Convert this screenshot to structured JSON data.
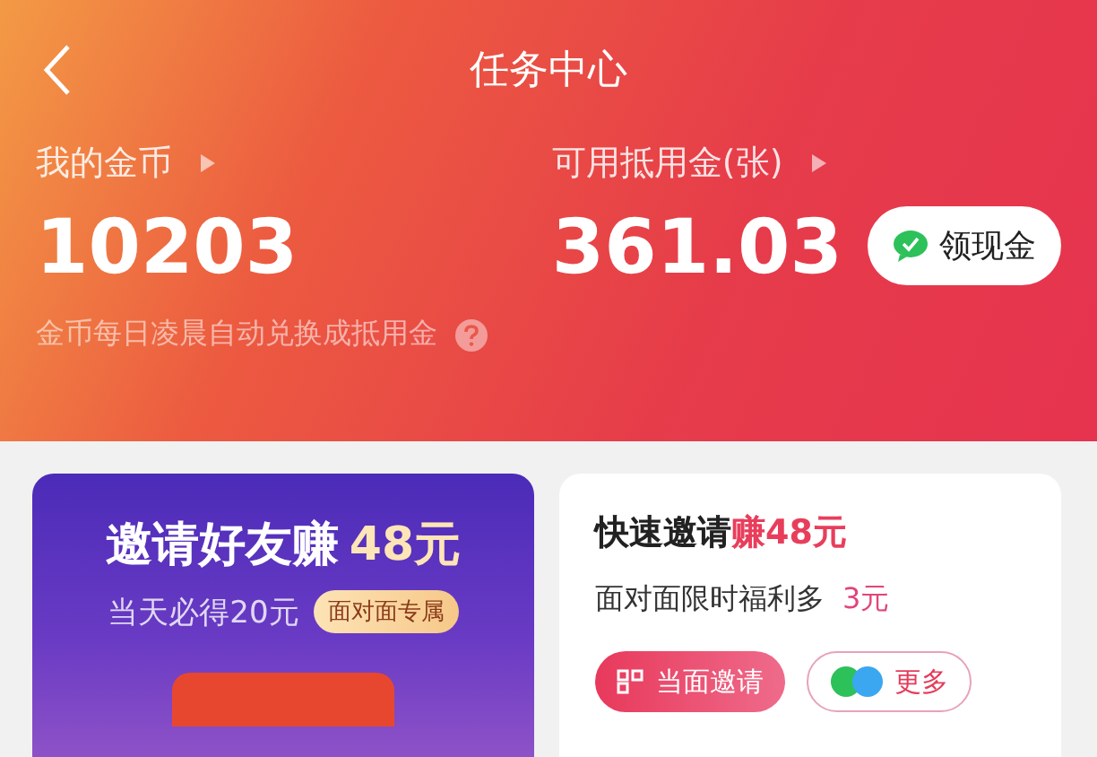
{
  "nav": {
    "title": "任务中心"
  },
  "stats": [
    {
      "label": "我的金币",
      "value": "10203"
    },
    {
      "label": "可用抵用金(张)",
      "value": "361.03",
      "action": "领现金"
    }
  ],
  "hint": "金币每日凌晨自动兑换成抵用金",
  "invite_card": {
    "title": "邀请好友赚",
    "amount": "48元",
    "subtitle": "当天必得20元",
    "tag": "面对面专属"
  },
  "quick_card": {
    "title": "快速邀请",
    "highlight": "赚48元",
    "subtitle": "面对面限时福利多",
    "bonus": "3元",
    "buttons": [
      {
        "kind": "primary",
        "label": "当面邀请"
      },
      {
        "kind": "secondary",
        "label": "更多"
      }
    ]
  }
}
